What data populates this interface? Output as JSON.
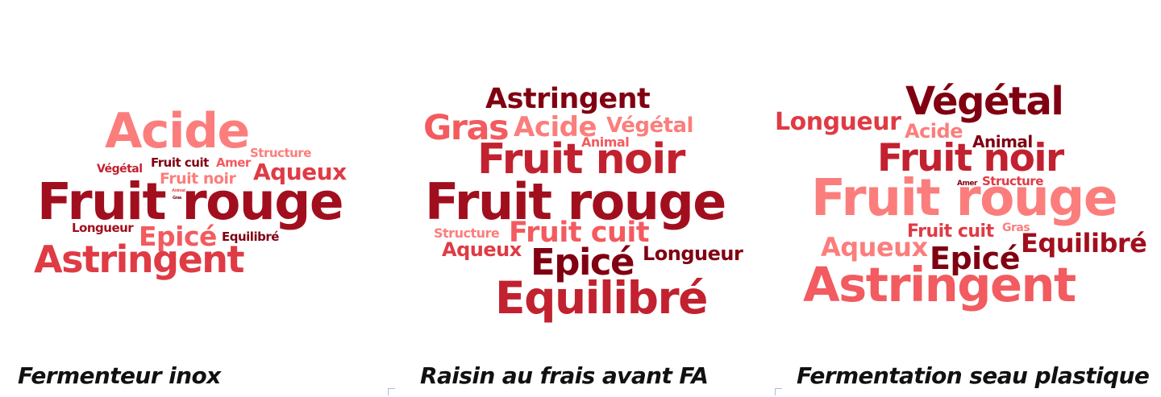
{
  "colors": {
    "c1": "#fb7e7c",
    "c2": "#f25b5f",
    "c3": "#df3b45",
    "c4": "#c2212f",
    "c5": "#a10f1e",
    "c6": "#800012"
  },
  "clouds": [
    {
      "caption": "Fermenteur inox",
      "words": [
        {
          "text": "Acide",
          "color": "c1"
        },
        {
          "text": "Structure",
          "color": "c1"
        },
        {
          "text": "Végétal",
          "color": "c4"
        },
        {
          "text": "Fruit cuit",
          "color": "c6"
        },
        {
          "text": "Amer",
          "color": "c2"
        },
        {
          "text": "Aqueux",
          "color": "c3"
        },
        {
          "text": "Fruit noir",
          "color": "c1"
        },
        {
          "text": "Animal",
          "color": "c2"
        },
        {
          "text": "Gras",
          "color": "c6"
        },
        {
          "text": "Fruit rouge",
          "color": "c5"
        },
        {
          "text": "Longueur",
          "color": "c5"
        },
        {
          "text": "Epicé",
          "color": "c2"
        },
        {
          "text": "Equilibré",
          "color": "c6"
        },
        {
          "text": "Astringent",
          "color": "c3"
        }
      ]
    },
    {
      "caption": "Raisin au frais avant FA",
      "words": [
        {
          "text": "Astringent",
          "color": "c6"
        },
        {
          "text": "Gras",
          "color": "c2"
        },
        {
          "text": "Acide",
          "color": "c1"
        },
        {
          "text": "Végétal",
          "color": "c1"
        },
        {
          "text": "Animal",
          "color": "c2"
        },
        {
          "text": "Fruit noir",
          "color": "c4"
        },
        {
          "text": "Fruit rouge",
          "color": "c5"
        },
        {
          "text": "Structure",
          "color": "c1"
        },
        {
          "text": "Fruit cuit",
          "color": "c2"
        },
        {
          "text": "Aqueux",
          "color": "c3"
        },
        {
          "text": "Epicé",
          "color": "c6"
        },
        {
          "text": "Longueur",
          "color": "c6"
        },
        {
          "text": "Equilibré",
          "color": "c4"
        }
      ]
    },
    {
      "caption": "Fermentation seau plastique",
      "words": [
        {
          "text": "Végétal",
          "color": "c6"
        },
        {
          "text": "Longueur",
          "color": "c3"
        },
        {
          "text": "Acide",
          "color": "c1"
        },
        {
          "text": "Animal",
          "color": "c6"
        },
        {
          "text": "Fruit noir",
          "color": "c4"
        },
        {
          "text": "Amer",
          "color": "c6"
        },
        {
          "text": "Structure",
          "color": "c3"
        },
        {
          "text": "Fruit rouge",
          "color": "c1"
        },
        {
          "text": "Fruit cuit",
          "color": "c3"
        },
        {
          "text": "Gras",
          "color": "c1"
        },
        {
          "text": "Aqueux",
          "color": "c1"
        },
        {
          "text": "Equilibré",
          "color": "c5"
        },
        {
          "text": "Epicé",
          "color": "c6"
        },
        {
          "text": "Astringent",
          "color": "c2"
        }
      ]
    }
  ]
}
